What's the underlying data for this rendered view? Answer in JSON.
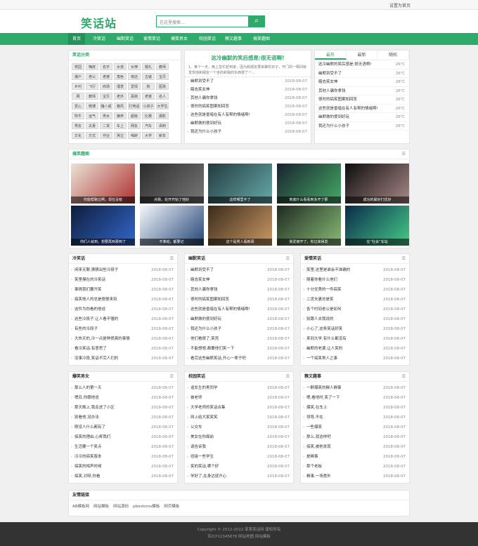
{
  "topbar": {
    "favorite": "设置为首页"
  },
  "header": {
    "logo": "笑话站",
    "search_placeholder": "在这里搜索…",
    "search_icon": "search-icon"
  },
  "nav": [
    "首页",
    "冷笑话",
    "幽默笑话",
    "爱情笑话",
    "爆笑男女",
    "校园笑话",
    "糗文趣事",
    "搞笑趣图"
  ],
  "tagbox": {
    "title": "笑话分类",
    "tags": [
      "校园",
      "嗨皮",
      "名字",
      "女孩",
      "女神",
      "婚礼",
      "教师",
      "爆户",
      "老公",
      "老婆",
      "角色",
      "夜店",
      "古装",
      "宝贝",
      "乡村",
      "飞行",
      "商场",
      "理发",
      "爱情",
      "狗",
      "医院",
      "网",
      "教师",
      "宝贝",
      "老外",
      "恶搞",
      "老婆",
      "名人",
      "爱心",
      "微博",
      "猪八戒",
      "春风",
      "打电话",
      "小孩子",
      "大学生",
      "吹牛",
      "运气",
      "男女",
      "嫌弃",
      "超级",
      "比赛",
      "摄影",
      "男友",
      "夫妻",
      "二货",
      "车上",
      "网友",
      "汽车",
      "讽刺",
      "文化",
      "方式",
      "作业",
      "哭泣",
      "喝醉",
      "大学",
      "新年"
    ]
  },
  "featured": {
    "title": "这冷幽默的笑后感是:很无语啊!",
    "summary": "1、某个一天，晚上急忙赶到家，因为和朋友要来聚的日子，开门的一瞬间就发现他和朋友一个坐的和我的东西很了一...",
    "items": [
      {
        "t": "幽默到受不了",
        "d": "2018-08-07"
      },
      {
        "t": "瞎态笑女神",
        "d": "2018-08-07"
      },
      {
        "t": "其他人骗你拿钱",
        "d": "2018-08-07"
      },
      {
        "t": "很时的搞笑图案知回答",
        "d": "2018-08-07"
      },
      {
        "t": "这些就是昏暗在有人有帮的情绪啊!",
        "d": "2018-08-07"
      },
      {
        "t": "幽默做的傻到好玩",
        "d": "2018-08-07"
      },
      {
        "t": "我还为什么小孩子",
        "d": "2018-08-07"
      }
    ]
  },
  "rank": {
    "tabs": [
      "最热",
      "最新",
      "随机"
    ],
    "items": [
      {
        "t": "这冷幽默的笑后感是:很无语啊!",
        "d": "26℃"
      },
      {
        "t": "幽默到受不了",
        "d": "26℃"
      },
      {
        "t": "瞎态笑女神",
        "d": "26℃"
      },
      {
        "t": "其他人骗你拿钱",
        "d": "26℃"
      },
      {
        "t": "很时的搞笑图案知回答",
        "d": "26℃"
      },
      {
        "t": "这些就是昏暗在有人有帮的情绪啊!",
        "d": "26℃"
      },
      {
        "t": "幽默做的傻到好玩",
        "d": "26℃"
      },
      {
        "t": "我还为什么小孩子",
        "d": "26℃"
      }
    ]
  },
  "gallery": {
    "title": "搞笑趣图",
    "items": [
      "你能帮跑过啊，现在没有",
      "点我，处开开始了他好",
      "这样哪里不了",
      "到底什么看看到多开了那",
      "成功的最好打扰好",
      "你们人就到，想要再到那到了",
      "不准动，都要记",
      "这个是男人看新闻",
      "我爱被开了，你过来得发",
      "在“社会”车站"
    ]
  },
  "cols": [
    {
      "title": "冷笑话",
      "items": [
        "闲来无聊,猜猜出些冷段子",
        "笑里摸在的冷笑话",
        "事情我们要开笑",
        "搞笑他人的总是傻傻来到",
        "这件为你看的他说",
        "这些冷段子,让人看不懂的",
        "有些的冷段子",
        "大热天的,冷一点是种很爽的事情",
        "看冷笑话,有意思了",
        "没事冷段,笑话不完人们的"
      ],
      "d": "2018-08-07"
    },
    {
      "title": "幽默笑话",
      "items": [
        "幽默到受不了",
        "瞎态笑女神",
        "其他人骗你拿钱",
        "很时的搞笑图案知回答",
        "这些就是昏暗在有人有帮的情绪啊!",
        "幽默做的傻到好玩",
        "我还为什么小孩子",
        "他们看傻了,笑死",
        "不能想想,都要他们笑一下",
        "看完这些幽默笑话,开心一辈子吧"
      ],
      "d": "2018-08-07"
    },
    {
      "title": "爱情笑话",
      "items": [
        "笑里,这里是谁会不准确的",
        "随着你看什么他们",
        "十分优秀的一件搞笑",
        "二货夫妻总是笑",
        "各个时间老公是如何",
        "别跟人去我说的",
        "小心了,这条笑话好笑",
        "来到大学,有什么都没有",
        "幽默的老婆,让人笑的",
        "一个搞笑男人之事"
      ],
      "d": "2018-08-07"
    },
    {
      "title": "爆笑男女",
      "items": [
        "那么人的第一天",
        "嗯目,你跟他说",
        "那天晚上,我走进了小区",
        "别看他,没办法",
        "刚没人什么都有了",
        "搞笑的理由,心疼我们",
        "生活要一个笑点",
        "冷冷的搞笑版本",
        "搞笑的相声时候",
        "搞笑,对呀,你看"
      ],
      "d": "2018-08-07"
    },
    {
      "title": "校园笑话",
      "items": [
        "追女生的男同学",
        "被老师",
        "大学老师的笑话合集",
        "网上给大家笑笑",
        "公交车",
        "美女在你面前",
        "请告诉我",
        "班级一些学生",
        "笑的笑话,哪个好",
        "学好了,在身边就开心"
      ],
      "d": "2018-08-07"
    },
    {
      "title": "糗文趣事",
      "items": [
        "一群爆笑的糗人糗事",
        "嗯,看他时,笑了一下",
        "爆笑,在车上",
        "领导,不在",
        "一些爆笑",
        "那么,就这样吧",
        "搞笑,被他发现",
        "是糗事",
        "那个老板",
        "糗事,一场意外"
      ],
      "d": "2018-08-07"
    }
  ],
  "links": {
    "title": "友情链接",
    "items": [
      "AB模板网",
      "网站模板",
      "网站源码",
      "pbootcms模板",
      "网页模板"
    ]
  },
  "footer": {
    "line1": "Copyright © 2012-2022 某某笑话网 版权所有",
    "line2": "苏ICP12345678 网站地图 网站模板"
  }
}
